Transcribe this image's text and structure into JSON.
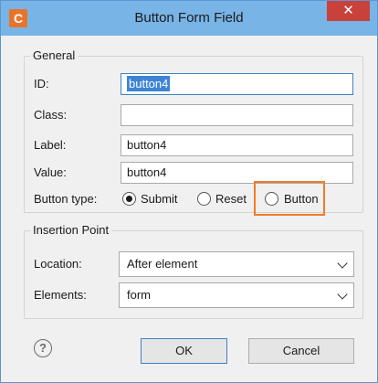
{
  "window": {
    "title": "Button Form Field",
    "app_icon": "C",
    "close_glyph": "✕"
  },
  "general": {
    "legend": "General",
    "id_label": "ID:",
    "id_value": "button4",
    "class_label": "Class:",
    "class_value": "",
    "label_label": "Label:",
    "label_value": "button4",
    "value_label": "Value:",
    "value_value": "button4",
    "button_type_label": "Button type:",
    "button_type_options": [
      "Submit",
      "Reset",
      "Button"
    ],
    "button_type_selected": "Submit"
  },
  "insertion": {
    "legend": "Insertion Point",
    "location_label": "Location:",
    "location_value": "After element",
    "elements_label": "Elements:",
    "elements_value": "form"
  },
  "footer": {
    "help_glyph": "?",
    "ok_label": "OK",
    "cancel_label": "Cancel"
  },
  "colors": {
    "titlebar": "#78b4e6",
    "close": "#c9413b",
    "app_icon": "#e8742b",
    "highlight": "#f07c28",
    "selection": "#3d84d6"
  }
}
